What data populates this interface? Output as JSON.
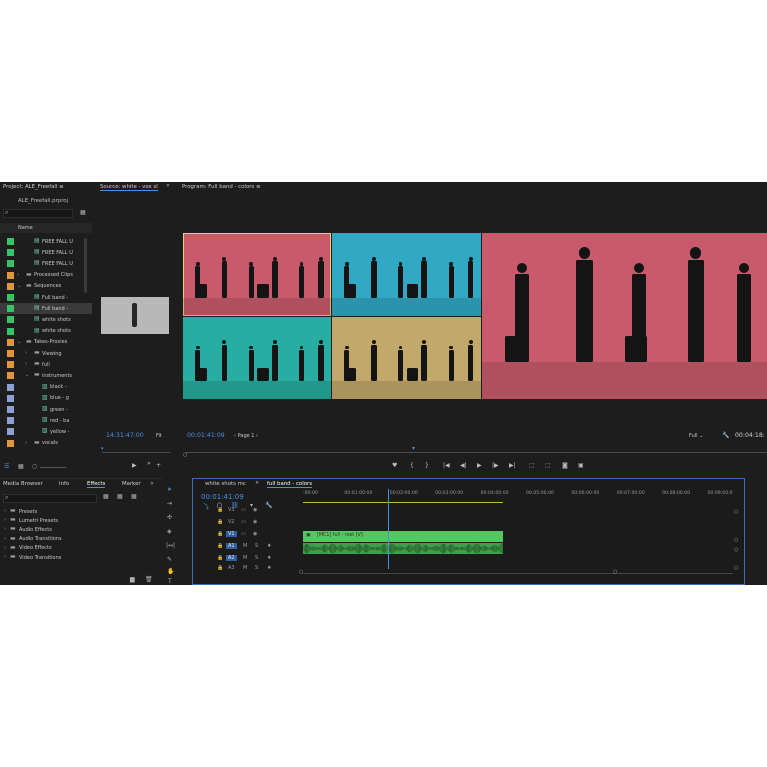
{
  "project": {
    "title": "Project: ALE_Freefall",
    "file": "ALE_Freefall.prproj",
    "column_name": "Name",
    "items": [
      {
        "label": "FREE FALL U",
        "indent": 2,
        "color": "#35c46a",
        "kind": "sequence",
        "arrow": ""
      },
      {
        "label": "FREE FALL U",
        "indent": 2,
        "color": "#35c46a",
        "kind": "sequence",
        "arrow": ""
      },
      {
        "label": "FREE FALL U",
        "indent": 2,
        "color": "#35c46a",
        "kind": "sequence",
        "arrow": ""
      },
      {
        "label": "Processed Clips",
        "indent": 1,
        "color": "#e2963a",
        "kind": "folder",
        "arrow": "›"
      },
      {
        "label": "Sequences",
        "indent": 1,
        "color": "#e2963a",
        "kind": "folder",
        "arrow": "⌄"
      },
      {
        "label": "Full band -",
        "indent": 2,
        "color": "#35c46a",
        "kind": "sequence",
        "arrow": ""
      },
      {
        "label": "Full band -",
        "indent": 2,
        "color": "#35c46a",
        "kind": "sequence",
        "arrow": "",
        "selected": true
      },
      {
        "label": "white shots",
        "indent": 2,
        "color": "#35c46a",
        "kind": "sequence",
        "arrow": ""
      },
      {
        "label": "white shots",
        "indent": 2,
        "color": "#35c46a",
        "kind": "sequence",
        "arrow": ""
      },
      {
        "label": "Takes-Proxies",
        "indent": 1,
        "color": "#e2963a",
        "kind": "folder",
        "arrow": "⌄"
      },
      {
        "label": "Viewing",
        "indent": 2,
        "color": "#e2963a",
        "kind": "folder",
        "arrow": "›"
      },
      {
        "label": "full",
        "indent": 2,
        "color": "#e2963a",
        "kind": "folder",
        "arrow": "›"
      },
      {
        "label": "instruments",
        "indent": 2,
        "color": "#e2963a",
        "kind": "folder",
        "arrow": "⌄"
      },
      {
        "label": "black -",
        "indent": 3,
        "color": "#8e9fd6",
        "kind": "clip",
        "arrow": ""
      },
      {
        "label": "blue - g",
        "indent": 3,
        "color": "#8e9fd6",
        "kind": "clip",
        "arrow": ""
      },
      {
        "label": "green -",
        "indent": 3,
        "color": "#8e9fd6",
        "kind": "clip",
        "arrow": ""
      },
      {
        "label": "red - ba",
        "indent": 3,
        "color": "#8e9fd6",
        "kind": "clip",
        "arrow": ""
      },
      {
        "label": "yellow -",
        "indent": 3,
        "color": "#8e9fd6",
        "kind": "clip",
        "arrow": ""
      },
      {
        "label": "vocals",
        "indent": 2,
        "color": "#e2963a",
        "kind": "folder",
        "arrow": "›"
      }
    ]
  },
  "source": {
    "tab": "Source: white - vox sl",
    "timecode": "14:31:47:00",
    "fit": "Fit"
  },
  "program": {
    "tab": "Program: Full band - colors",
    "timecode": "00:01:41:09",
    "page": "Page 1",
    "quality": "Full",
    "duration": "00:04:18:",
    "cam_colors": [
      "#c95a6c",
      "#31a9c4",
      "#27ada1",
      "#c2a86a"
    ],
    "preview_color": "#c95a6c"
  },
  "effects": {
    "tabs": [
      "Media Browser",
      "Info",
      "Effects",
      "Marker"
    ],
    "active_tab": "Effects",
    "items": [
      "Presets",
      "Lumetri Presets",
      "Audio Effects",
      "Audio Transitions",
      "Video Effects",
      "Video Transitions"
    ]
  },
  "timeline": {
    "tabs": [
      "white shots mc",
      "full band - colors"
    ],
    "active_tab": "full band - colors",
    "timecode": "00:01:41:09",
    "ruler": [
      ":00:00",
      "00:01:00:00",
      "00:02:00:00",
      "00:03:00:00",
      "00:04:00:00",
      "00:05:00:00",
      "00:06:00:00",
      "00:07:00:00",
      "00:08:00:00",
      "00:09:00:0"
    ],
    "tracks": [
      "V3",
      "V2",
      "V1",
      "A1",
      "A2",
      "A3"
    ],
    "video_clip": "[MC1] full - rest [V]",
    "playhead_fraction": 0.195
  },
  "colors": {
    "accent": "#4a8fe0",
    "clip_green": "#55c75e"
  }
}
